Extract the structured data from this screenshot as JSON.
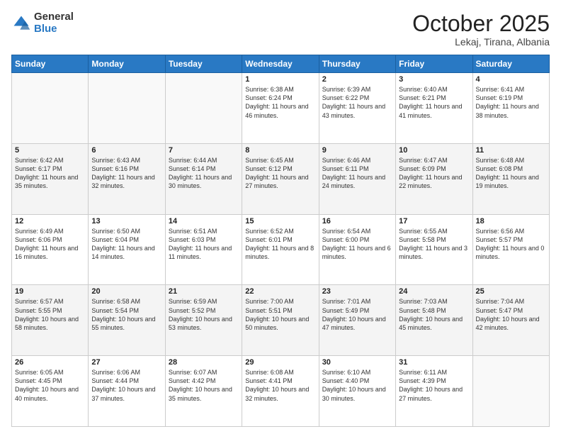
{
  "logo": {
    "general": "General",
    "blue": "Blue"
  },
  "title": "October 2025",
  "subtitle": "Lekaj, Tirana, Albania",
  "days_of_week": [
    "Sunday",
    "Monday",
    "Tuesday",
    "Wednesday",
    "Thursday",
    "Friday",
    "Saturday"
  ],
  "weeks": [
    [
      {
        "day": "",
        "info": ""
      },
      {
        "day": "",
        "info": ""
      },
      {
        "day": "",
        "info": ""
      },
      {
        "day": "1",
        "info": "Sunrise: 6:38 AM\nSunset: 6:24 PM\nDaylight: 11 hours and 46 minutes."
      },
      {
        "day": "2",
        "info": "Sunrise: 6:39 AM\nSunset: 6:22 PM\nDaylight: 11 hours and 43 minutes."
      },
      {
        "day": "3",
        "info": "Sunrise: 6:40 AM\nSunset: 6:21 PM\nDaylight: 11 hours and 41 minutes."
      },
      {
        "day": "4",
        "info": "Sunrise: 6:41 AM\nSunset: 6:19 PM\nDaylight: 11 hours and 38 minutes."
      }
    ],
    [
      {
        "day": "5",
        "info": "Sunrise: 6:42 AM\nSunset: 6:17 PM\nDaylight: 11 hours and 35 minutes."
      },
      {
        "day": "6",
        "info": "Sunrise: 6:43 AM\nSunset: 6:16 PM\nDaylight: 11 hours and 32 minutes."
      },
      {
        "day": "7",
        "info": "Sunrise: 6:44 AM\nSunset: 6:14 PM\nDaylight: 11 hours and 30 minutes."
      },
      {
        "day": "8",
        "info": "Sunrise: 6:45 AM\nSunset: 6:12 PM\nDaylight: 11 hours and 27 minutes."
      },
      {
        "day": "9",
        "info": "Sunrise: 6:46 AM\nSunset: 6:11 PM\nDaylight: 11 hours and 24 minutes."
      },
      {
        "day": "10",
        "info": "Sunrise: 6:47 AM\nSunset: 6:09 PM\nDaylight: 11 hours and 22 minutes."
      },
      {
        "day": "11",
        "info": "Sunrise: 6:48 AM\nSunset: 6:08 PM\nDaylight: 11 hours and 19 minutes."
      }
    ],
    [
      {
        "day": "12",
        "info": "Sunrise: 6:49 AM\nSunset: 6:06 PM\nDaylight: 11 hours and 16 minutes."
      },
      {
        "day": "13",
        "info": "Sunrise: 6:50 AM\nSunset: 6:04 PM\nDaylight: 11 hours and 14 minutes."
      },
      {
        "day": "14",
        "info": "Sunrise: 6:51 AM\nSunset: 6:03 PM\nDaylight: 11 hours and 11 minutes."
      },
      {
        "day": "15",
        "info": "Sunrise: 6:52 AM\nSunset: 6:01 PM\nDaylight: 11 hours and 8 minutes."
      },
      {
        "day": "16",
        "info": "Sunrise: 6:54 AM\nSunset: 6:00 PM\nDaylight: 11 hours and 6 minutes."
      },
      {
        "day": "17",
        "info": "Sunrise: 6:55 AM\nSunset: 5:58 PM\nDaylight: 11 hours and 3 minutes."
      },
      {
        "day": "18",
        "info": "Sunrise: 6:56 AM\nSunset: 5:57 PM\nDaylight: 11 hours and 0 minutes."
      }
    ],
    [
      {
        "day": "19",
        "info": "Sunrise: 6:57 AM\nSunset: 5:55 PM\nDaylight: 10 hours and 58 minutes."
      },
      {
        "day": "20",
        "info": "Sunrise: 6:58 AM\nSunset: 5:54 PM\nDaylight: 10 hours and 55 minutes."
      },
      {
        "day": "21",
        "info": "Sunrise: 6:59 AM\nSunset: 5:52 PM\nDaylight: 10 hours and 53 minutes."
      },
      {
        "day": "22",
        "info": "Sunrise: 7:00 AM\nSunset: 5:51 PM\nDaylight: 10 hours and 50 minutes."
      },
      {
        "day": "23",
        "info": "Sunrise: 7:01 AM\nSunset: 5:49 PM\nDaylight: 10 hours and 47 minutes."
      },
      {
        "day": "24",
        "info": "Sunrise: 7:03 AM\nSunset: 5:48 PM\nDaylight: 10 hours and 45 minutes."
      },
      {
        "day": "25",
        "info": "Sunrise: 7:04 AM\nSunset: 5:47 PM\nDaylight: 10 hours and 42 minutes."
      }
    ],
    [
      {
        "day": "26",
        "info": "Sunrise: 6:05 AM\nSunset: 4:45 PM\nDaylight: 10 hours and 40 minutes."
      },
      {
        "day": "27",
        "info": "Sunrise: 6:06 AM\nSunset: 4:44 PM\nDaylight: 10 hours and 37 minutes."
      },
      {
        "day": "28",
        "info": "Sunrise: 6:07 AM\nSunset: 4:42 PM\nDaylight: 10 hours and 35 minutes."
      },
      {
        "day": "29",
        "info": "Sunrise: 6:08 AM\nSunset: 4:41 PM\nDaylight: 10 hours and 32 minutes."
      },
      {
        "day": "30",
        "info": "Sunrise: 6:10 AM\nSunset: 4:40 PM\nDaylight: 10 hours and 30 minutes."
      },
      {
        "day": "31",
        "info": "Sunrise: 6:11 AM\nSunset: 4:39 PM\nDaylight: 10 hours and 27 minutes."
      },
      {
        "day": "",
        "info": ""
      }
    ]
  ]
}
